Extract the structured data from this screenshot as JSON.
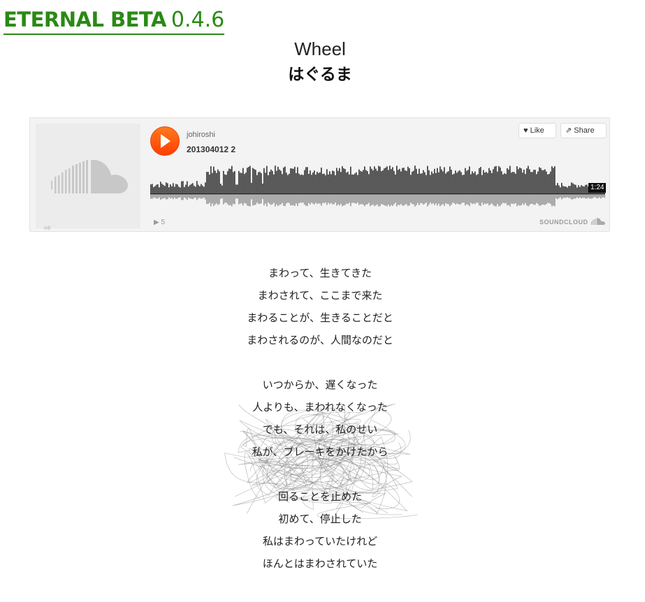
{
  "site": {
    "brand": "ETERNAL BETA",
    "version": "0.4.6",
    "accent": "#2a8a14"
  },
  "post": {
    "title_en": "Wheel",
    "title_ja": "はぐるま"
  },
  "soundcloud": {
    "user": "johiroshi",
    "track": "201304012 2",
    "like_label": "Like",
    "share_label": "Share",
    "duration": "1:24",
    "plays": "5",
    "logo_text": "SOUNDCLOUD",
    "play_color": "#ff5500",
    "icons": [
      "soundcloud-cloud-icon",
      "play-icon",
      "heart-icon",
      "share-icon",
      "share-arrow-icon",
      "soundcloud-mini-icon"
    ]
  },
  "lyrics": {
    "stanzas": [
      [
        "まわって、生きてきた",
        "まわされて、ここまで来た",
        "まわることが、生きることだと",
        "まわされるのが、人間なのだと"
      ],
      [
        "いつからか、遅くなった",
        "人よりも、まわれなくなった",
        "でも、それは、私のせい",
        "私が、ブレーキをかけたから"
      ],
      [
        "回ることを止めた",
        "初めて、停止した",
        "私はまわっていたけれど",
        "ほんとはまわされていた"
      ]
    ]
  }
}
